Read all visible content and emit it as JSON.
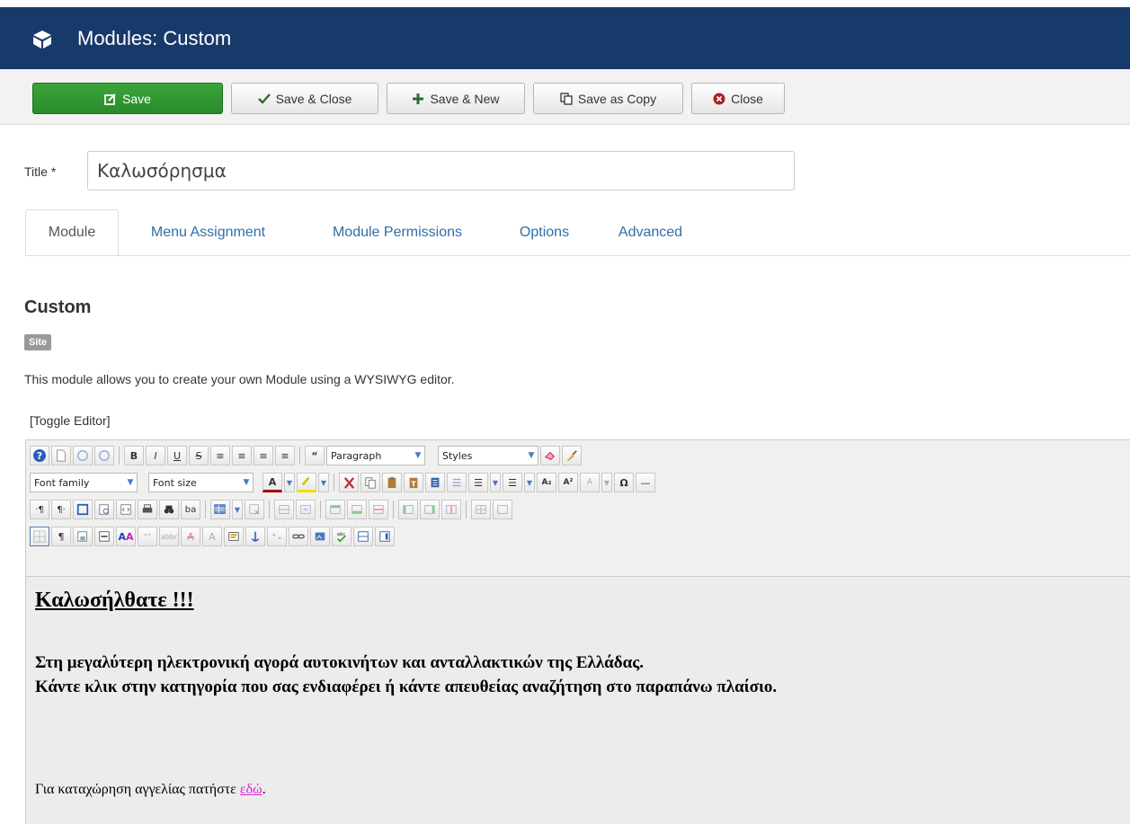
{
  "header": {
    "title": "Modules: Custom",
    "icon": "cube-icon",
    "color": "#183a6a"
  },
  "toolbar": {
    "save": "Save",
    "save_close": "Save & Close",
    "save_new": "Save & New",
    "save_copy": "Save as Copy",
    "close": "Close",
    "save_color": "#2f8f2f"
  },
  "form": {
    "title_label": "Title *",
    "title_value": "Καλωσόρησμα"
  },
  "tabs": [
    {
      "label": "Module",
      "active": true
    },
    {
      "label": "Menu Assignment"
    },
    {
      "label": "Module Permissions"
    },
    {
      "label": "Options"
    },
    {
      "label": "Advanced"
    }
  ],
  "module": {
    "heading": "Custom",
    "badge": "Site",
    "description": "This module allows you to create your own Module using a WYSIWYG editor.",
    "toggle_editor": "[Toggle Editor]"
  },
  "editor": {
    "format_select": "Paragraph",
    "styles_select": "Styles",
    "font_family": "Font family",
    "font_size": "Font size",
    "content": {
      "heading": "Καλωσήλθατε !!!",
      "line1": "Στη μεγαλύτερη ηλεκτρονική αγορά αυτοκινήτων και ανταλλακτικών της Ελλάδας.",
      "line2": "Κάντε κλικ στην κατηγορία που σας ενδιαφέρει ή κάντε απευθείας αναζήτηση στο παραπάνω πλαίσιο.",
      "line3_text": "Για καταχώρηση αγγελίας πατήστε ",
      "line3_link": "εδώ",
      "line3_end": "."
    }
  }
}
